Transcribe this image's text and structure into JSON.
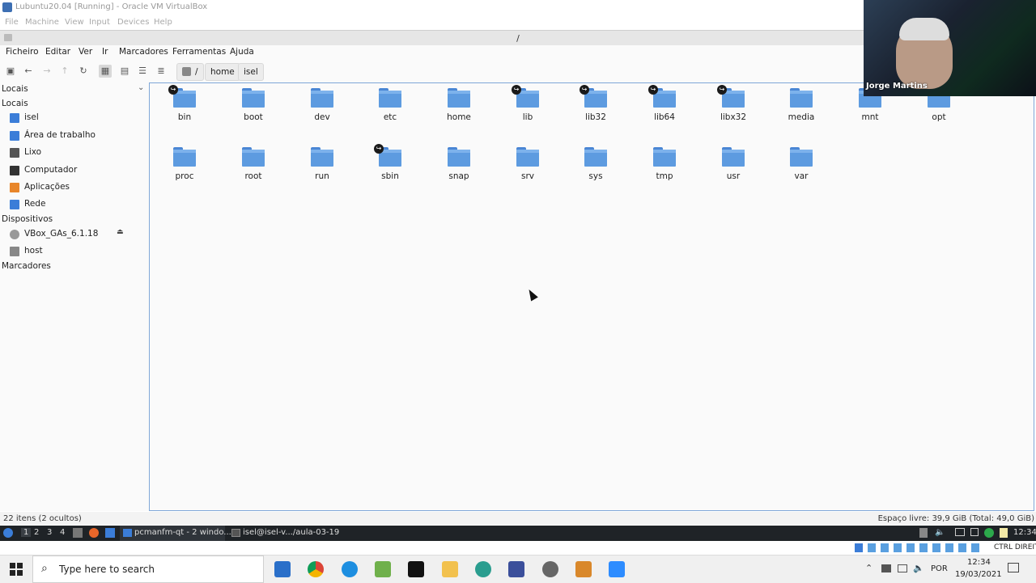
{
  "host_window": {
    "title": "Lubuntu20.04 [Running] - Oracle VM VirtualBox",
    "menu": [
      "File",
      "Machine",
      "View",
      "Input",
      "Devices",
      "Help"
    ]
  },
  "guest_window": {
    "title": "/"
  },
  "fm_menu": [
    "Ficheiro",
    "Editar",
    "Ver",
    "Ir",
    "Marcadores",
    "Ferramentas",
    "Ajuda"
  ],
  "toolbar": {
    "icons": [
      "new-tab-icon",
      "back-icon",
      "forward-icon",
      "up-icon",
      "refresh-icon",
      "icon-view-icon",
      "thumbnail-view-icon",
      "compact-view-icon",
      "detailed-view-icon"
    ],
    "breadcrumbs": [
      "/",
      "home",
      "isel"
    ]
  },
  "sidebar": {
    "dropdown_label": "Locais",
    "sections": [
      {
        "title": "Locais",
        "items": [
          {
            "label": "isel",
            "icon": "home-icon",
            "color": "#3b7dd8"
          },
          {
            "label": "Área de trabalho",
            "icon": "desktop-icon",
            "color": "#3b7dd8"
          },
          {
            "label": "Lixo",
            "icon": "trash-icon",
            "color": "#555555"
          },
          {
            "label": "Computador",
            "icon": "computer-icon",
            "color": "#333333"
          },
          {
            "label": "Aplicações",
            "icon": "applications-icon",
            "color": "#e8862a"
          },
          {
            "label": "Rede",
            "icon": "network-icon",
            "color": "#3b7dd8"
          }
        ]
      },
      {
        "title": "Dispositivos",
        "items": [
          {
            "label": "VBox_GAs_6.1.18",
            "icon": "disc-icon",
            "color": "#999999"
          },
          {
            "label": "host",
            "icon": "drive-icon",
            "color": "#888888"
          }
        ]
      },
      {
        "title": "Marcadores",
        "items": []
      }
    ]
  },
  "files": [
    {
      "name": "bin",
      "link": true
    },
    {
      "name": "boot",
      "link": false
    },
    {
      "name": "dev",
      "link": false
    },
    {
      "name": "etc",
      "link": false
    },
    {
      "name": "home",
      "link": false
    },
    {
      "name": "lib",
      "link": true
    },
    {
      "name": "lib32",
      "link": true
    },
    {
      "name": "lib64",
      "link": true
    },
    {
      "name": "libx32",
      "link": true
    },
    {
      "name": "media",
      "link": false
    },
    {
      "name": "mnt",
      "link": false
    },
    {
      "name": "opt",
      "link": false
    },
    {
      "name": "proc",
      "link": false
    },
    {
      "name": "root",
      "link": false
    },
    {
      "name": "run",
      "link": false
    },
    {
      "name": "sbin",
      "link": true
    },
    {
      "name": "snap",
      "link": false
    },
    {
      "name": "srv",
      "link": false
    },
    {
      "name": "sys",
      "link": false
    },
    {
      "name": "tmp",
      "link": false
    },
    {
      "name": "usr",
      "link": false
    },
    {
      "name": "var",
      "link": false
    }
  ],
  "status": {
    "left": "22 itens (2 ocultos)",
    "right": "Espaço livre: 39,9 GiB (Total: 49,0 GiB)"
  },
  "guest_taskbar": {
    "workspaces": [
      "1",
      "2",
      "3",
      "4"
    ],
    "tasks": [
      "pcmanfm-qt - 2 windo...",
      "isel@isel-v.../aula-03-19"
    ],
    "clock": "12:34"
  },
  "host_tray": {
    "label": "CTRL DIREITO"
  },
  "windows_taskbar": {
    "search_placeholder": "Type here to search",
    "language": "POR",
    "time": "12:34",
    "date": "19/03/2021"
  },
  "webcam": {
    "name": "Jorge Martins"
  }
}
